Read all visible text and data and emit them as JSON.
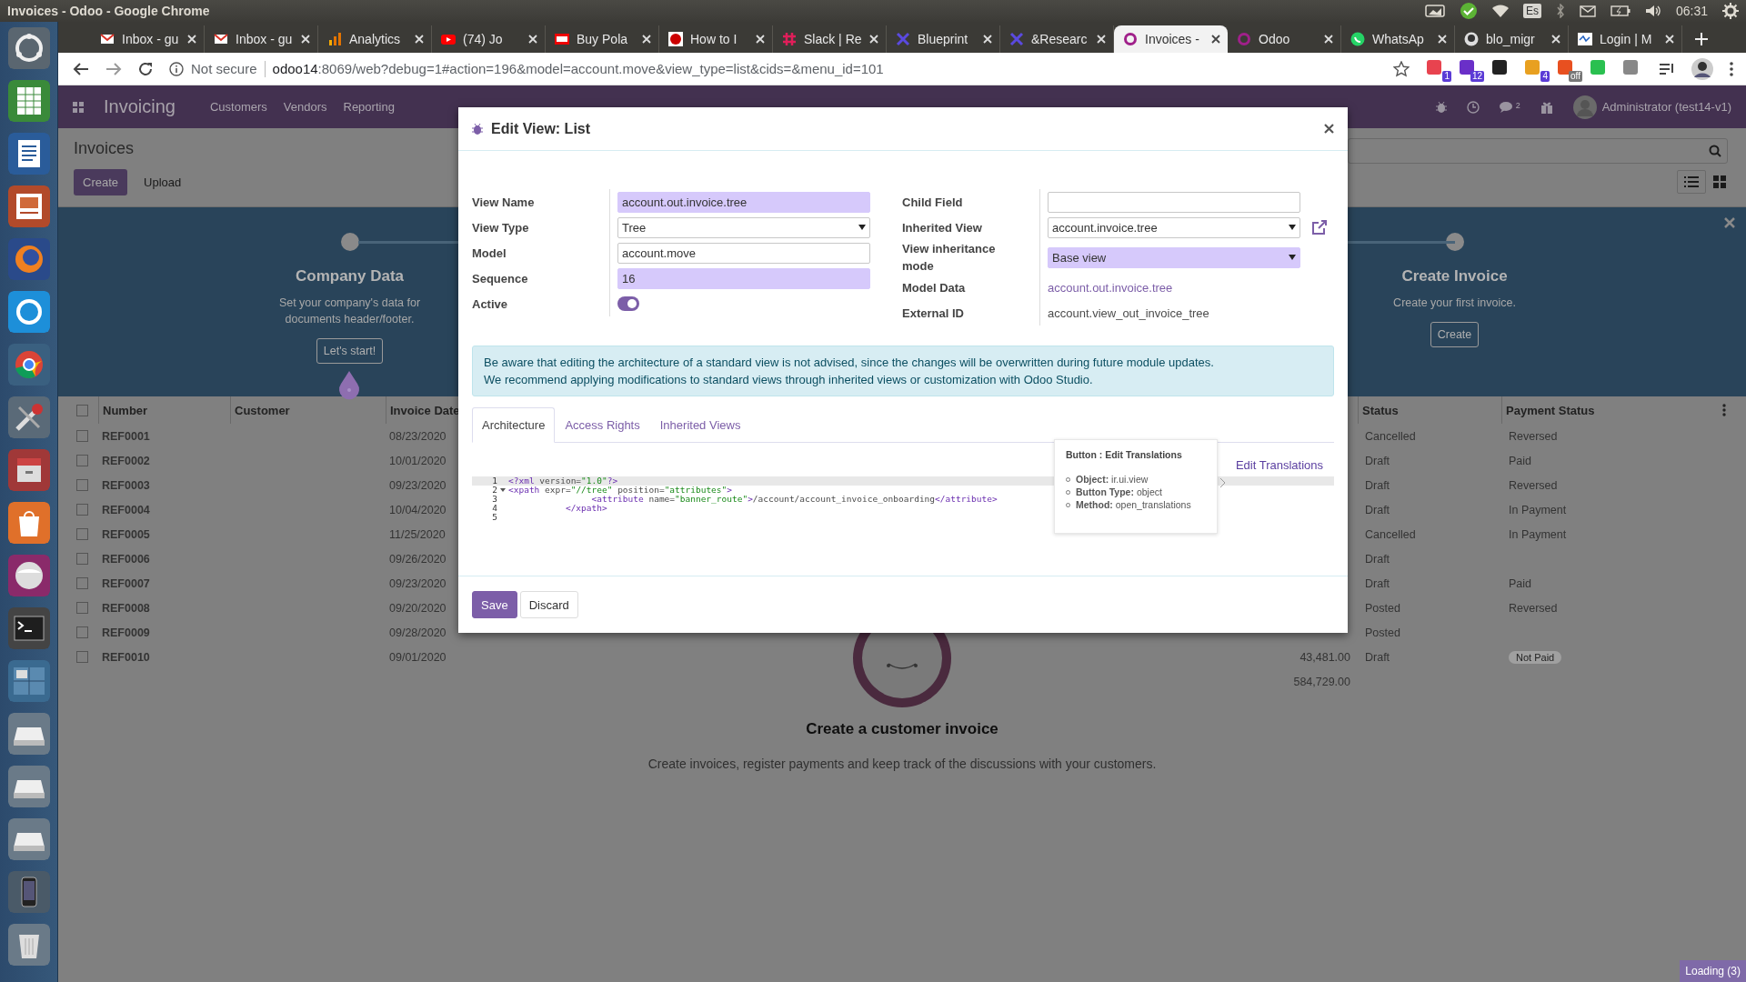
{
  "window": {
    "title": "Invoices - Odoo - Google Chrome"
  },
  "system_tray": {
    "keyboard": "Es",
    "clock": "06:31"
  },
  "browser_tabs": [
    {
      "title": "Inbox - gu",
      "selected": false
    },
    {
      "title": "Inbox - gu",
      "selected": false
    },
    {
      "title": "Analytics",
      "selected": false
    },
    {
      "title": "(74) Jo",
      "selected": false
    },
    {
      "title": "Buy Pola",
      "selected": false
    },
    {
      "title": "How to I",
      "selected": false
    },
    {
      "title": "Slack | Re",
      "selected": false
    },
    {
      "title": "Blueprint",
      "selected": false
    },
    {
      "title": "&Researc",
      "selected": false
    },
    {
      "title": "Invoices -",
      "selected": true
    },
    {
      "title": "Odoo",
      "selected": false
    },
    {
      "title": "WhatsAp",
      "selected": false
    },
    {
      "title": "blo_migr",
      "selected": false
    },
    {
      "title": "Login | M",
      "selected": false
    }
  ],
  "address_bar": {
    "security": "Not secure",
    "host": "odoo14",
    "path": ":8069/web?debug=1#action=196&model=account.move&view_type=list&cids=&menu_id=101"
  },
  "extensions": [
    {
      "kind": "badge",
      "badge": "1"
    },
    {
      "kind": "badge",
      "badge": "12"
    },
    {
      "kind": "plain"
    },
    {
      "kind": "badge",
      "badge": "4"
    },
    {
      "kind": "badge",
      "badge": "off"
    },
    {
      "kind": "plain"
    },
    {
      "kind": "plain"
    }
  ],
  "app": {
    "name": "Invoicing",
    "menu": [
      "Customers",
      "Vendors",
      "Reporting"
    ],
    "messages_count": "2",
    "user": "Administrator (test14-v1)"
  },
  "breadcrumb": "Invoices",
  "actions": [
    "Create",
    "Upload"
  ],
  "onboarding": {
    "steps": [
      {
        "title": "Company Data",
        "text": "Set your company's data for documents header/footer.",
        "button": "Let's start!"
      },
      {
        "title": "Create Invoice",
        "text": "Create your first invoice.",
        "button": "Create"
      }
    ]
  },
  "list": {
    "columns": [
      "Number",
      "Customer",
      "Invoice Date",
      "Status",
      "Payment Status"
    ],
    "select_all_checked": false,
    "rows": [
      {
        "checked": false,
        "number": "REF0001",
        "invoice_date": "08/23/2020",
        "status": "Cancelled",
        "payment_status": "Reversed",
        "payment_badge": false
      },
      {
        "checked": false,
        "number": "REF0002",
        "invoice_date": "10/01/2020",
        "status": "Draft",
        "payment_status": "Paid",
        "payment_badge": false
      },
      {
        "checked": false,
        "number": "REF0003",
        "invoice_date": "09/23/2020",
        "status": "Draft",
        "payment_status": "Reversed",
        "payment_badge": false
      },
      {
        "checked": false,
        "number": "REF0004",
        "invoice_date": "10/04/2020",
        "status": "Draft",
        "payment_status": "In Payment",
        "payment_badge": false
      },
      {
        "checked": false,
        "number": "REF0005",
        "invoice_date": "11/25/2020",
        "status": "Cancelled",
        "payment_status": "In Payment",
        "payment_badge": false
      },
      {
        "checked": false,
        "number": "REF0006",
        "invoice_date": "09/26/2020",
        "status": "Draft"
      },
      {
        "checked": false,
        "number": "REF0007",
        "invoice_date": "09/23/2020",
        "status": "Draft",
        "payment_status": "Paid",
        "payment_badge": false
      },
      {
        "checked": false,
        "number": "REF0008",
        "invoice_date": "09/20/2020",
        "status": "Posted",
        "payment_status": "Reversed",
        "payment_badge": false
      },
      {
        "checked": false,
        "number": "REF0009",
        "invoice_date": "09/28/2020",
        "status": "Posted"
      },
      {
        "checked": false,
        "number": "REF0010",
        "invoice_date": "09/01/2020",
        "amount": "43,481.00",
        "status": "Draft",
        "payment_status": "Not Paid",
        "payment_badge": true
      }
    ],
    "total": "584,729.00"
  },
  "helper": {
    "title": "Create a customer invoice",
    "text": "Create invoices, register payments and keep track of the discussions with your customers."
  },
  "dialog": {
    "title": "Edit View: List",
    "left_fields": [
      {
        "label": "View Name",
        "kind": "text",
        "value": "account.out.invoice.tree",
        "required": true
      },
      {
        "label": "View Type",
        "kind": "select",
        "value": "Tree",
        "required": false
      },
      {
        "label": "Model",
        "kind": "text",
        "value": "account.move",
        "required": false
      },
      {
        "label": "Sequence",
        "kind": "text",
        "value": "16",
        "required": true
      },
      {
        "label": "Active",
        "kind": "toggle",
        "on": true
      }
    ],
    "right_fields": [
      {
        "label": "Child Field",
        "kind": "text",
        "required": false
      },
      {
        "label": "Inherited View",
        "kind": "combo",
        "value": "account.invoice.tree",
        "required": false
      },
      {
        "label": "View inheritance mode",
        "kind": "select",
        "value": "Base view",
        "required": true
      },
      {
        "label": "Model Data",
        "kind": "link",
        "value": "account.out.invoice.tree"
      },
      {
        "label": "External ID",
        "kind": "plain",
        "value": "account.view_out_invoice_tree"
      }
    ],
    "warning": [
      "Be aware that editing the architecture of a standard view is not advised, since the changes will be overwritten during future module updates.",
      "We recommend applying modifications to standard views through inherited views or customization with Odoo Studio."
    ],
    "tabs": [
      {
        "label": "Architecture",
        "selected": true
      },
      {
        "label": "Access Rights",
        "selected": false
      },
      {
        "label": "Inherited Views",
        "selected": false
      }
    ],
    "edit_translations": "Edit Translations",
    "code_lines": [
      {
        "number": "1",
        "text": "<?xml version=\"1.0\"?>",
        "foldable": false,
        "active": true
      },
      {
        "number": "2",
        "text": "<xpath expr=\"//tree\" position=\"attributes\">",
        "foldable": true,
        "active": false
      },
      {
        "number": "3",
        "text": "                <attribute name=\"banner_route\">/account/account_invoice_onboarding</attribute>",
        "foldable": false,
        "active": false
      },
      {
        "number": "4",
        "text": "           </xpath>",
        "foldable": false,
        "active": false
      },
      {
        "number": "5",
        "foldable": false,
        "active": false
      }
    ],
    "tooltip": {
      "title": "Button : Edit Translations",
      "items": [
        "**Object:** ir.ui.view",
        "**Button Type:** object",
        "**Method:** open_translations"
      ]
    },
    "buttons": [
      "Save",
      "Discard"
    ]
  },
  "loading": "Loading (3)"
}
